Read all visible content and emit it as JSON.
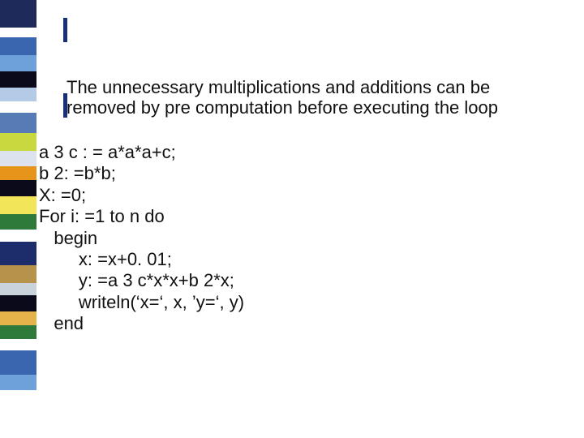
{
  "description": "The unnecessary multiplications and additions can be removed  by pre computation before executing the loop",
  "code": {
    "l1": "a 3 c : = a*a*a+c;",
    "l2": "b 2: =b*b;",
    "l3": "X: =0;",
    "l4": "For i: =1 to n do",
    "l5": "   begin",
    "l6": "        x: =x+0. 01;",
    "l7": "        y: =a 3 c*x*x+b 2*x;",
    "l8": "        writeln(‘x=‘, x, ’y=‘, y)",
    "l9": "   end"
  }
}
